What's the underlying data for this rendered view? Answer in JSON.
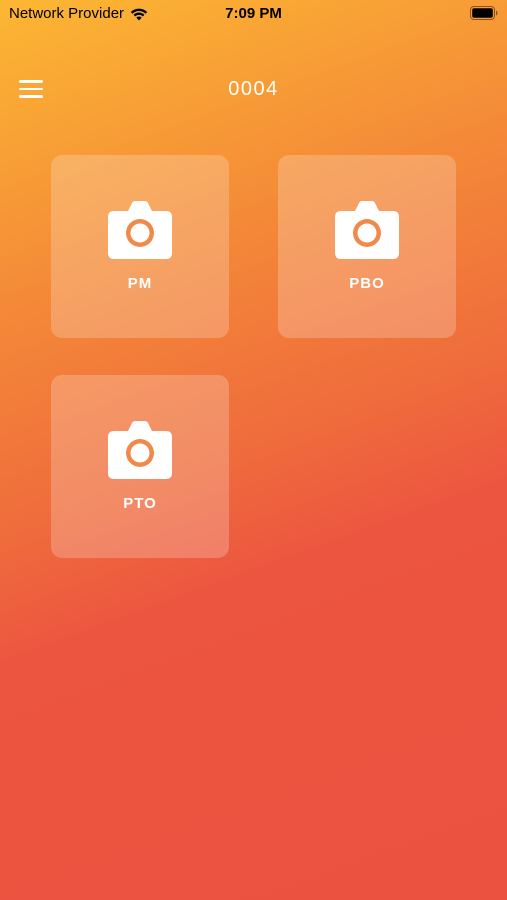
{
  "status_bar": {
    "carrier": "Network Provider",
    "time": "7:09 PM",
    "wifi_icon": "wifi-icon",
    "battery_icon": "battery-icon"
  },
  "nav": {
    "title": "0004",
    "menu_icon": "hamburger-menu-icon"
  },
  "tiles": [
    {
      "label": "PM",
      "icon": "camera-icon"
    },
    {
      "label": "PBO",
      "icon": "camera-icon"
    },
    {
      "label": "PTO",
      "icon": "camera-icon"
    }
  ],
  "colors": {
    "gradient_top": "#fcb733",
    "gradient_bottom": "#ec5240",
    "icon_accent": "#f08a4b"
  }
}
